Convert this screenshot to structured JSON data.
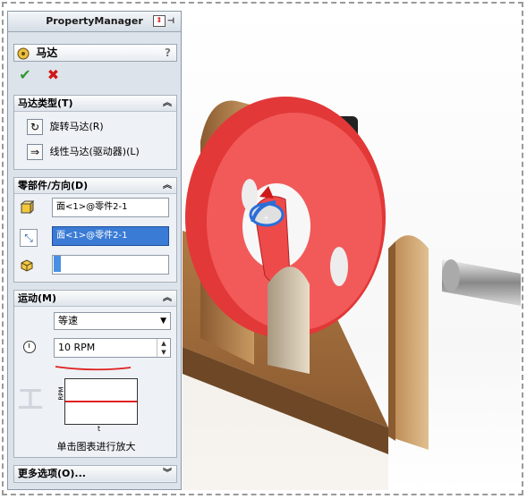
{
  "propertymanager": {
    "title": "PropertyManager",
    "feature_name": "马达",
    "help": "?",
    "ok_symbol": "✔",
    "cancel_symbol": "✖"
  },
  "motor_type": {
    "header": "马达类型(T)",
    "rotary_label": "旋转马达(R)",
    "linear_label": "线性马达(驱动器)(L)"
  },
  "component_direction": {
    "header": "零部件/方向(D)",
    "location_value": "面<1>@零件2-1",
    "direction_value": "面<1>@零件2-1",
    "component_value": ""
  },
  "motion": {
    "header": "运动(M)",
    "type_selected": "等速",
    "speed_value": "10 RPM",
    "graph_ylabel": "RPM",
    "graph_xlabel": "t",
    "graph_caption": "单击图表进行放大"
  },
  "more_options": {
    "header": "更多选项(O)..."
  },
  "colors": {
    "wheel": "#f04a4a",
    "wood": "#c89a62",
    "selection_blue": "#3a7bd5",
    "ok_green": "#2e9a2e",
    "cancel_red": "#d01818"
  }
}
